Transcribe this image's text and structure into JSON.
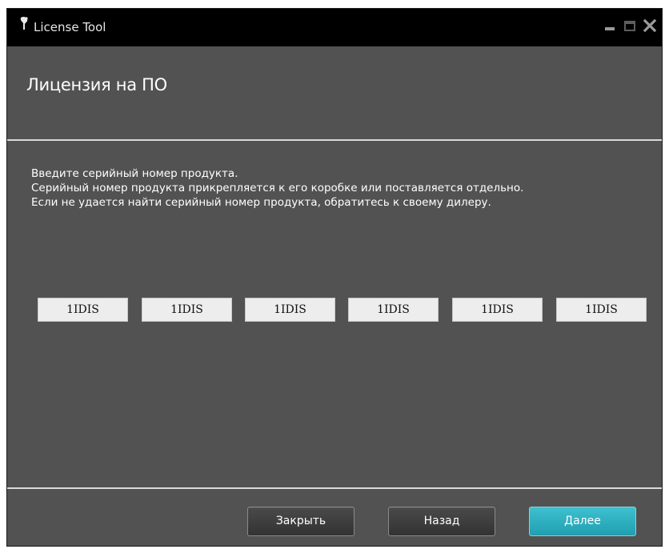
{
  "window": {
    "title": "License Tool"
  },
  "header": {
    "title": "Лицензия на ПО"
  },
  "instructions": {
    "line1": "Введите серийный номер продукта.",
    "line2": "Серийный номер продукта прикрепляется к его коробке или поставляется отдельно.",
    "line3": "Если не удается найти серийный номер продукта, обратитесь к своему дилеру."
  },
  "serial": {
    "fields": [
      "1IDIS",
      "1IDIS",
      "1IDIS",
      "1IDIS",
      "1IDIS",
      "1IDIS"
    ]
  },
  "buttons": {
    "close": "Закрыть",
    "back": "Назад",
    "next": "Далее"
  },
  "icons": {
    "app": "app-icon",
    "minimize": "minimize-icon",
    "maximize": "maximize-icon",
    "close": "close-icon"
  },
  "colors": {
    "background": "#525252",
    "titlebar": "#000000",
    "accent": "#2db3c2",
    "field": "#ededed"
  }
}
